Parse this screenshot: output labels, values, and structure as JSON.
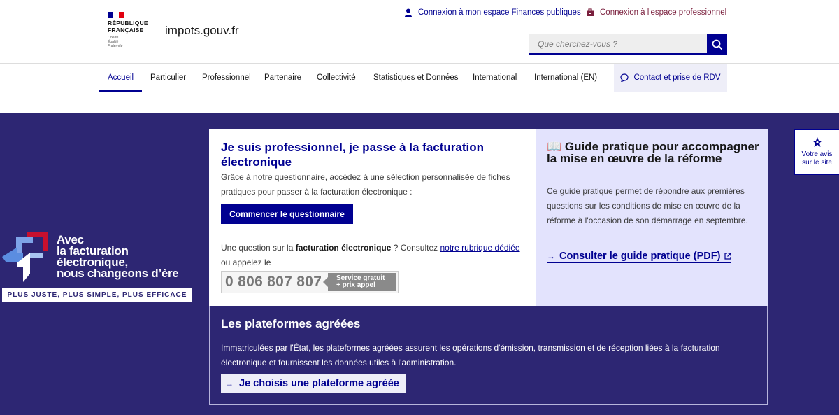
{
  "header": {
    "republique_line1": "RÉPUBLIQUE",
    "republique_line2": "FRANÇAISE",
    "devise": [
      "Liberté",
      "Égalité",
      "Fraternité"
    ],
    "site_name": "impots.gouv.fr",
    "link_finances": "Connexion à mon espace Finances publiques",
    "link_pro": "Connexion à l'espace professionnel",
    "search_placeholder": "Que cherchez-vous ?"
  },
  "nav": {
    "items": [
      "Accueil",
      "Particulier",
      "Professionnel",
      "Partenaire",
      "Collectivité",
      "Statistiques et Données",
      "International",
      "International (EN)"
    ],
    "active": "Accueil",
    "contact": "Contact et prise de RDV"
  },
  "brand": {
    "line1": "Avec",
    "line2": "la facturation",
    "line3": "électronique,",
    "line4": "nous changeons d’ère",
    "slogan": "PLUS JUSTE, PLUS SIMPLE, PLUS EFFICACE"
  },
  "card": {
    "title": "Je suis professionnel, je passe à la facturation électronique",
    "text": "Grâce à notre questionnaire, accédez à une sélection personnalisée de fiches pratiques pour passer à la facturation électronique :",
    "button": "Commencer le questionnaire",
    "question_part1": "Une question sur la ",
    "question_bold": "facturation électronique",
    "question_part2": " ? Consultez ",
    "question_link": "notre rubrique dédiée",
    "question_part3": " ou appelez le",
    "phone": "0 806 807 807",
    "phone_tag1": "Service gratuit",
    "phone_tag2": "+ prix appel"
  },
  "guide": {
    "title": "Guide pratique pour accompagner la mise en œuvre de la réforme",
    "text": "Ce guide pratique permet de répondre aux premières questions sur les conditions de mise en œuvre de la réforme à l'occasion de son démarrage en septembre.",
    "link": "Consulter le guide pratique (PDF)"
  },
  "platforms": {
    "title": "Les plateformes agréées",
    "text": "Immatriculées par l'État, les plateformes agréées assurent les opérations d'émission, transmission et de réception liées à la facturation électronique et fournissent les données utiles à l'administration.",
    "button": "Je choisis une plateforme agréée"
  },
  "feedback": {
    "line1": "Votre avis",
    "line2": "sur le site"
  },
  "colors": {
    "primary": "#000091",
    "hero_bg": "#2d2673",
    "guide_bg": "#e3e3fd",
    "flag_red": "#e1000f"
  }
}
